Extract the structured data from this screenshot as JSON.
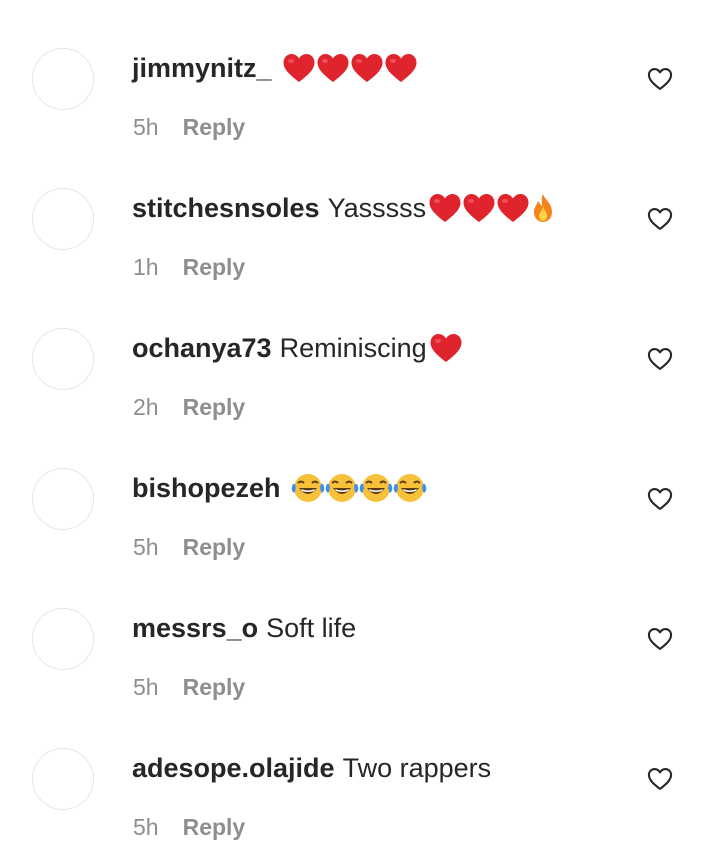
{
  "comments": [
    {
      "username": "jimmynitz_",
      "text": "",
      "emojis": [
        "heart-emoji",
        "heart-emoji",
        "heart-emoji",
        "heart-emoji"
      ],
      "time": "5h",
      "reply_label": "Reply"
    },
    {
      "username": "stitchesnsoles",
      "text": "Yasssss",
      "emojis": [
        "heart-emoji",
        "heart-emoji",
        "heart-emoji",
        "fire-emoji"
      ],
      "time": "1h",
      "reply_label": "Reply"
    },
    {
      "username": "ochanya73",
      "text": "Reminiscing",
      "emojis": [
        "heart-emoji"
      ],
      "time": "2h",
      "reply_label": "Reply"
    },
    {
      "username": "bishopezeh",
      "text": "",
      "emojis": [
        "laugh-emoji",
        "laugh-emoji",
        "laugh-emoji",
        "laugh-emoji"
      ],
      "time": "5h",
      "reply_label": "Reply"
    },
    {
      "username": "messrs_o",
      "text": "Soft life",
      "emojis": [],
      "time": "5h",
      "reply_label": "Reply"
    },
    {
      "username": "adesope.olajide",
      "text": "Two rappers",
      "emojis": [],
      "time": "5h",
      "reply_label": "Reply"
    }
  ],
  "icons": {
    "like": "heart-outline-icon"
  },
  "colors": {
    "text": "#262626",
    "meta": "#8e8e8e",
    "heart_emoji": "#e0242e"
  }
}
